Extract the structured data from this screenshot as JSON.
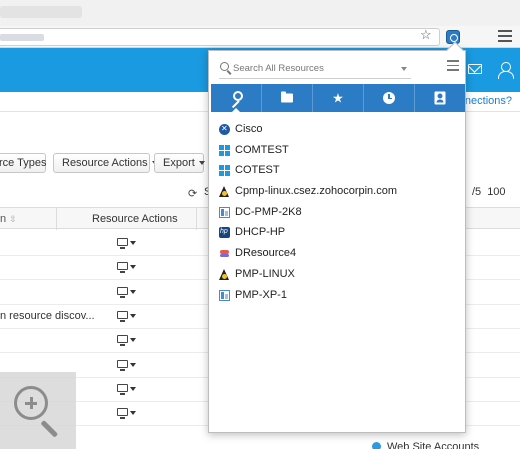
{
  "browser": {
    "bookmark_icon": "star-icon",
    "extension_icon": "password-manager-extension-icon",
    "menu_icon": "browser-menu-icon"
  },
  "app": {
    "header_color": "#1a9ae0",
    "header_icons": [
      "mail-icon",
      "user-profile-icon"
    ],
    "connections_link": "onnections?"
  },
  "toolbar": {
    "resource_types_label": "rce Types",
    "resource_actions_label": "Resource Actions",
    "export_label": "Export",
    "refresh_icon": "refresh-icon",
    "s_label": "S",
    "page_size_partial": "/5",
    "page_size_100": "100"
  },
  "table": {
    "columns": [
      {
        "label": "n",
        "sort_icon": "sort-icon"
      },
      {
        "label": "Resource Actions"
      }
    ],
    "rows": [
      {
        "text": ""
      },
      {
        "text": ""
      },
      {
        "text": ""
      },
      {
        "text": "n resource discov..."
      },
      {
        "text": ""
      },
      {
        "text": ""
      },
      {
        "text": ""
      },
      {
        "text": ""
      }
    ],
    "web_accounts_label": "Web Site Accounts"
  },
  "overlay": {
    "zoom_icon": "zoom-in-icon"
  },
  "popup": {
    "accent_color": "#2b7cc4",
    "search_placeholder": "Search All Resources",
    "tabs": [
      {
        "name": "passwords",
        "icon": "key-icon",
        "active": true
      },
      {
        "name": "folders",
        "icon": "folder-icon",
        "active": false
      },
      {
        "name": "favorites",
        "icon": "star-icon",
        "active": false
      },
      {
        "name": "recent",
        "icon": "clock-icon",
        "active": false
      },
      {
        "name": "contacts",
        "icon": "address-book-icon",
        "active": false
      }
    ],
    "resources": [
      {
        "label": "Cisco",
        "icon": "cisco"
      },
      {
        "label": "COMTEST",
        "icon": "windows"
      },
      {
        "label": "COTEST",
        "icon": "windows"
      },
      {
        "label": "Cpmp-linux.csez.zohocorpin.com",
        "icon": "linux"
      },
      {
        "label": "DC-PMP-2K8",
        "icon": "vm"
      },
      {
        "label": "DHCP-HP",
        "icon": "hp"
      },
      {
        "label": "DResource4",
        "icon": "dres"
      },
      {
        "label": "PMP-LINUX",
        "icon": "linux"
      },
      {
        "label": "PMP-XP-1",
        "icon": "vm"
      }
    ]
  }
}
